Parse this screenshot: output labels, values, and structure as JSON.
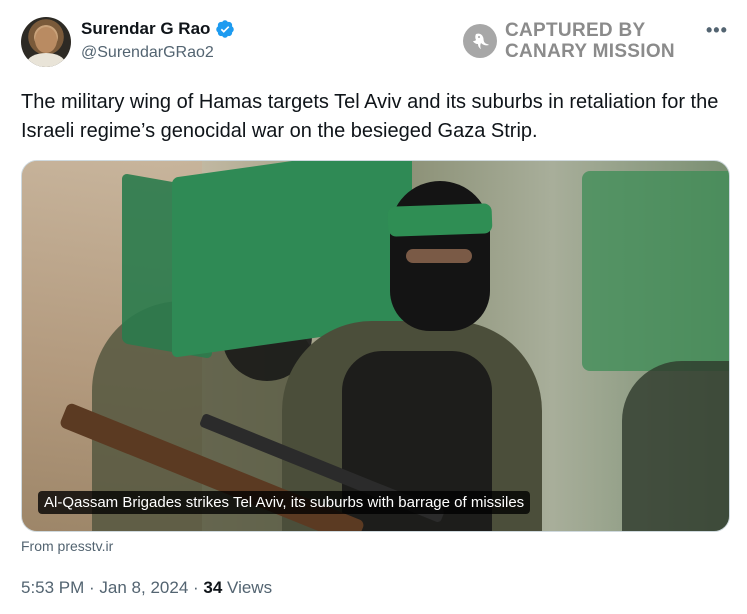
{
  "author": {
    "name": "Surendar G Rao",
    "handle": "@SurendarGRao2",
    "verified": true,
    "verified_color": "#1d9bf0"
  },
  "watermark": {
    "line1": "CAPTURED BY",
    "line2": "CANARY MISSION",
    "icon": "canary-bird-icon"
  },
  "more_menu": "•••",
  "tweet": {
    "text": "The military wing of Hamas targets Tel Aviv and its suburbs in retaliation for the Israeli regime’s genocidal war on the besieged Gaza Strip."
  },
  "media": {
    "caption": "Al-Qassam Brigades strikes Tel Aviv, its suburbs with barrage of missiles"
  },
  "link_source": "From presstv.ir",
  "meta": {
    "time": "5:53 PM",
    "sep1": " · ",
    "date": "Jan 8, 2024",
    "sep2": " · ",
    "views_count": "34",
    "views_label": " Views"
  }
}
